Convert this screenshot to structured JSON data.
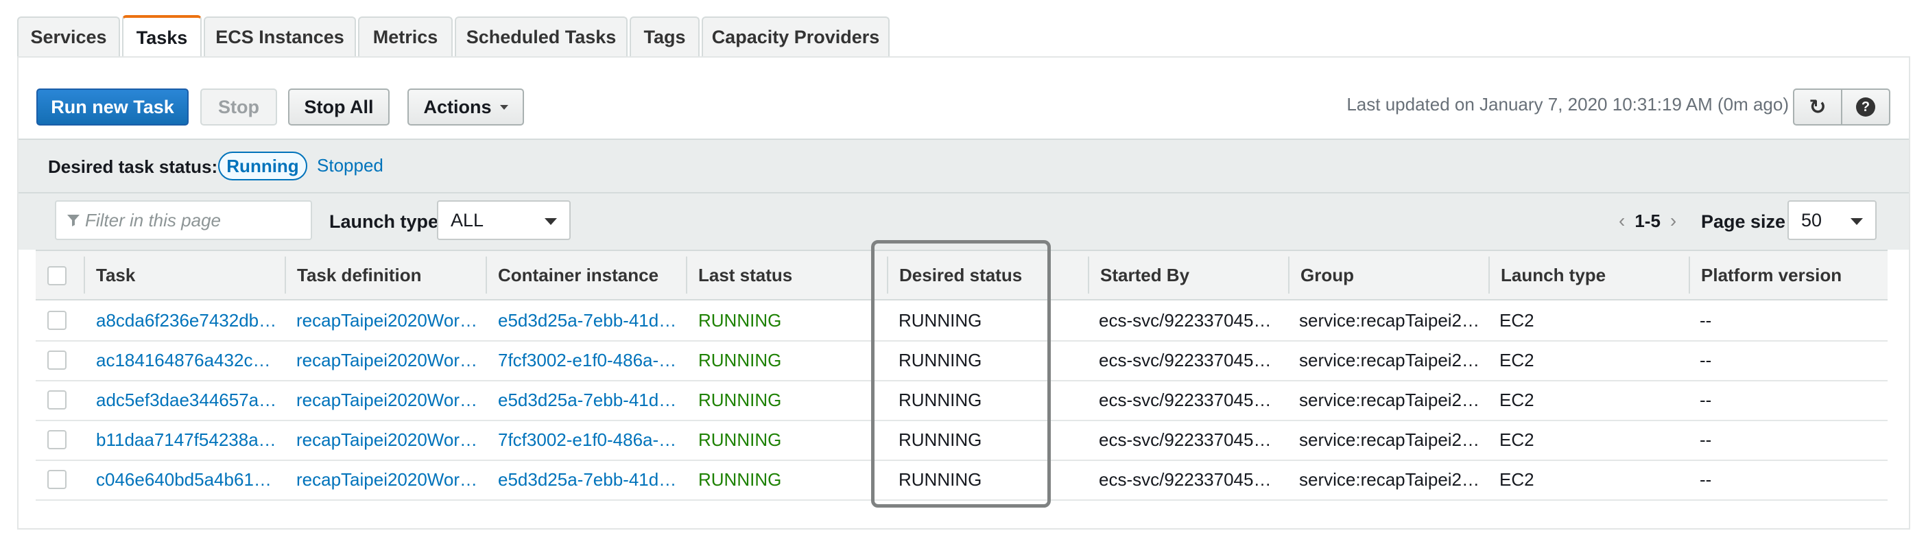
{
  "tabs": [
    "Services",
    "Tasks",
    "ECS Instances",
    "Metrics",
    "Scheduled Tasks",
    "Tags",
    "Capacity Providers"
  ],
  "active_tab": "Tasks",
  "toolbar": {
    "run_label": "Run new Task",
    "stop_label": "Stop",
    "stop_all_label": "Stop All",
    "actions_label": "Actions",
    "updated_text": "Last updated on January 7, 2020 10:31:19 AM (0m ago)",
    "refresh_icon": "↻",
    "help_icon": "?"
  },
  "status_filter": {
    "label": "Desired task status:",
    "running": "Running",
    "stopped": "Stopped"
  },
  "filter": {
    "placeholder": "Filter in this page",
    "launch_type_label": "Launch type",
    "launch_type_value": "ALL",
    "page_range": "1-5",
    "page_size_label": "Page size",
    "page_size": "50"
  },
  "table": {
    "columns": [
      "Task",
      "Task definition",
      "Container instance",
      "Last status",
      "Desired status",
      "Started By",
      "Group",
      "Launch type",
      "Platform version"
    ],
    "rows": [
      {
        "task": "a8cda6f236e7432db…",
        "def": "recapTaipei2020Wor…",
        "instance": "e5d3d25a-7ebb-41d…",
        "last": "RUNNING",
        "desired": "RUNNING",
        "started": "ecs-svc/922337045…",
        "group": "service:recapTaipei2…",
        "launch": "EC2",
        "platform": "--"
      },
      {
        "task": "ac184164876a432c…",
        "def": "recapTaipei2020Wor…",
        "instance": "7fcf3002-e1f0-486a-…",
        "last": "RUNNING",
        "desired": "RUNNING",
        "started": "ecs-svc/922337045…",
        "group": "service:recapTaipei2…",
        "launch": "EC2",
        "platform": "--"
      },
      {
        "task": "adc5ef3dae344657a…",
        "def": "recapTaipei2020Wor…",
        "instance": "e5d3d25a-7ebb-41d…",
        "last": "RUNNING",
        "desired": "RUNNING",
        "started": "ecs-svc/922337045…",
        "group": "service:recapTaipei2…",
        "launch": "EC2",
        "platform": "--"
      },
      {
        "task": "b11daa7147f54238a…",
        "def": "recapTaipei2020Wor…",
        "instance": "7fcf3002-e1f0-486a-…",
        "last": "RUNNING",
        "desired": "RUNNING",
        "started": "ecs-svc/922337045…",
        "group": "service:recapTaipei2…",
        "launch": "EC2",
        "platform": "--"
      },
      {
        "task": "c046e640bd5a4b61…",
        "def": "recapTaipei2020Wor…",
        "instance": "e5d3d25a-7ebb-41d…",
        "last": "RUNNING",
        "desired": "RUNNING",
        "started": "ecs-svc/922337045…",
        "group": "service:recapTaipei2…",
        "launch": "EC2",
        "platform": "--"
      }
    ]
  }
}
